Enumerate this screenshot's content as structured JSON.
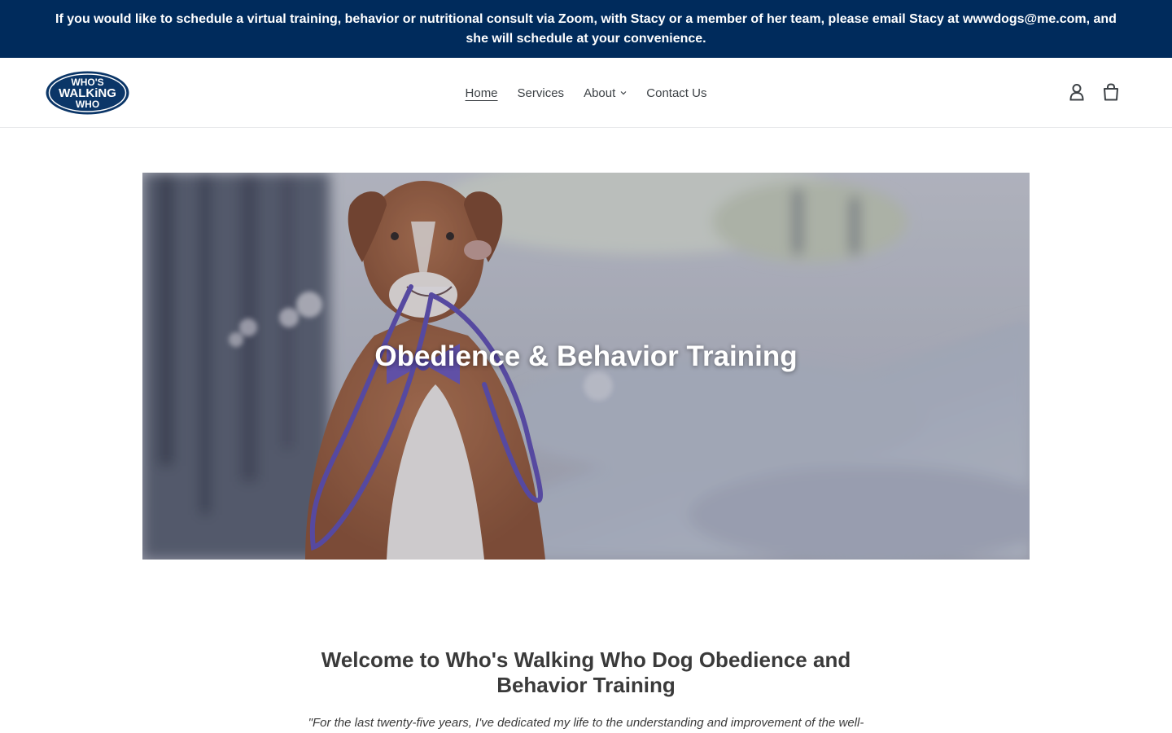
{
  "announcement": {
    "text": "If you would like to schedule a virtual training, behavior or nutritional consult via Zoom, with Stacy or a member of her team, please email Stacy at wwwdogs@me.com, and she will schedule at your convenience."
  },
  "header": {
    "logo": {
      "line1": "WHO'S",
      "line2": "WALKiNG",
      "line3": "WHO"
    },
    "nav": [
      {
        "label": "Home",
        "active": true
      },
      {
        "label": "Services"
      },
      {
        "label": "About",
        "has_dropdown": true
      },
      {
        "label": "Contact Us"
      }
    ],
    "icons": [
      "account-icon",
      "cart-icon"
    ]
  },
  "hero": {
    "title": "Obedience & Behavior Training",
    "image": "dog-holding-leash-photo"
  },
  "intro": {
    "heading": "Welcome to Who's Walking Who Dog Obedience and Behavior Training",
    "quote": "\"For the last twenty-five years, I've dedicated my life to the understanding and improvement of the well-"
  },
  "colors": {
    "announcement_bg": "#002b5c",
    "logo_blue": "#0b3668",
    "text": "#3a3a3a"
  }
}
